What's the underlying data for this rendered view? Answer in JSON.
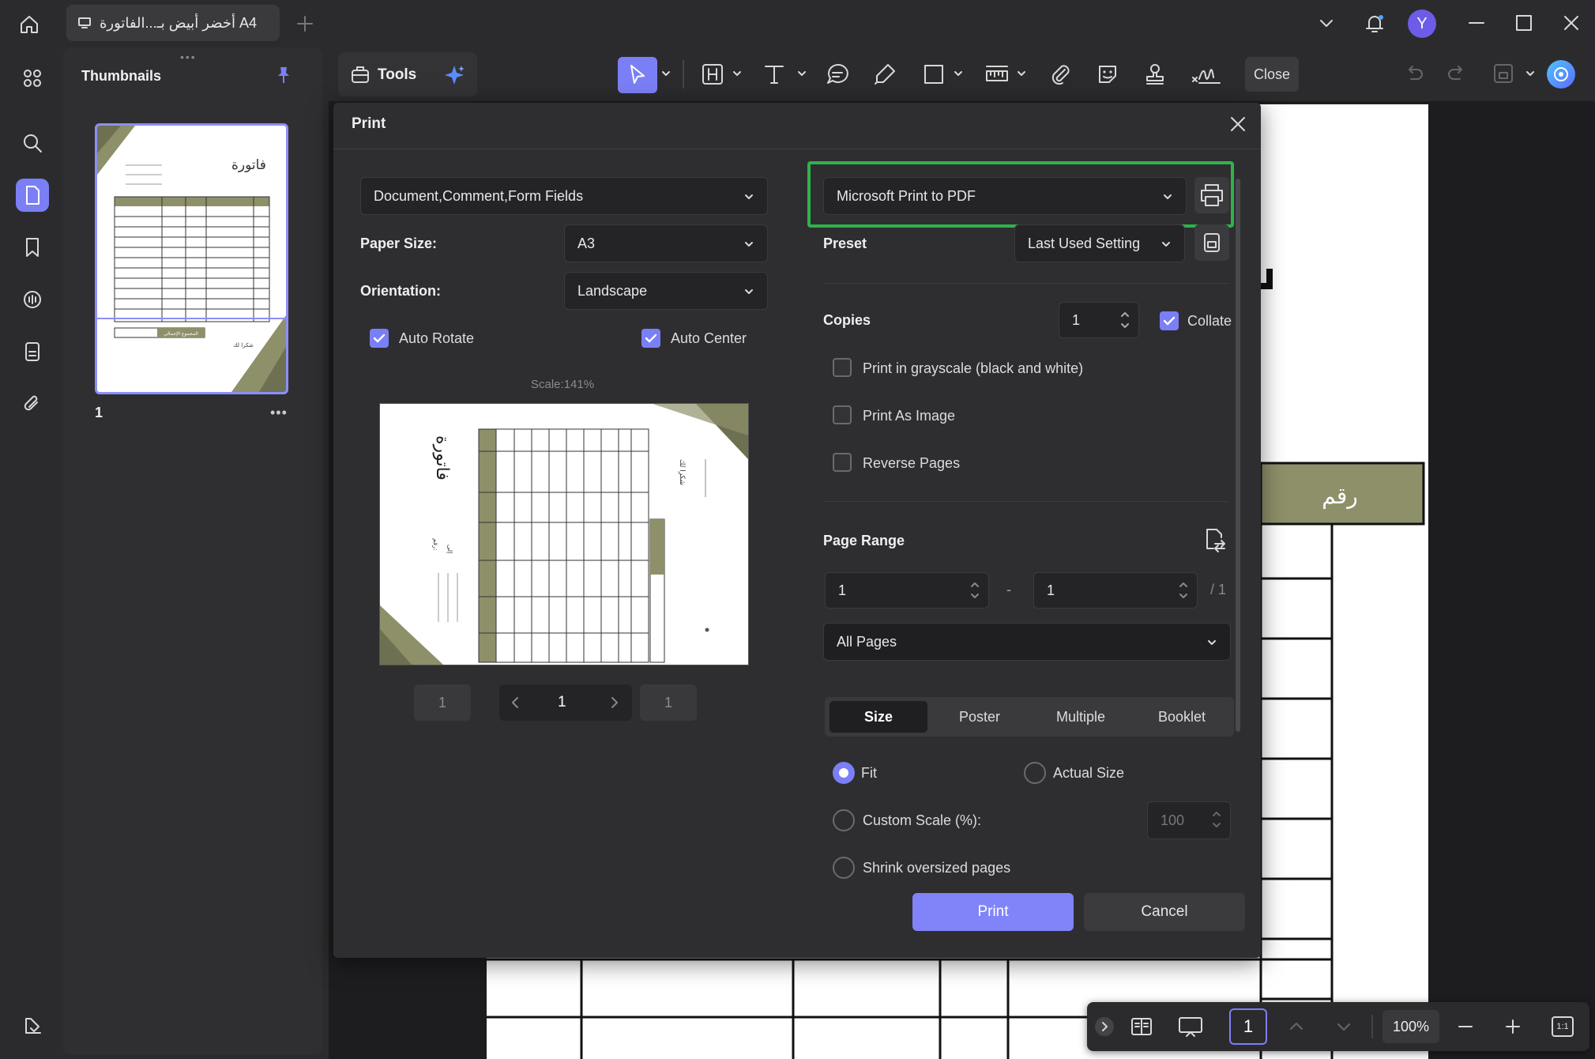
{
  "titlebar": {
    "tab_title": "أخضر أبيض بـ...الفاتورة A4",
    "avatar_letter": "Y"
  },
  "sidebar": {
    "thumbnails_title": "Thumbnails",
    "page_number": "1"
  },
  "toolbar": {
    "tools_label": "Tools",
    "close_label": "Close"
  },
  "dialog": {
    "title": "Print",
    "content_select": "Document,Comment,Form Fields",
    "paper_size_label": "Paper Size:",
    "paper_size_value": "A3",
    "orientation_label": "Orientation:",
    "orientation_value": "Landscape",
    "auto_rotate_label": "Auto Rotate",
    "auto_rotate_checked": true,
    "auto_center_label": "Auto Center",
    "auto_center_checked": true,
    "scale_text": "Scale:141%",
    "preview_prev_page": "1",
    "preview_current_page": "1",
    "preview_next_page": "1",
    "printer_value": "Microsoft Print to PDF",
    "preset_label": "Preset",
    "preset_value": "Last Used Setting",
    "copies_label": "Copies",
    "copies_value": "1",
    "collate_label": "Collate",
    "collate_checked": true,
    "grayscale_label": "Print in grayscale (black and white)",
    "print_as_image_label": "Print As Image",
    "reverse_pages_label": "Reverse Pages",
    "page_range_label": "Page Range",
    "range_from": "1",
    "range_dash": "-",
    "range_to": "1",
    "range_total": "/ 1",
    "pages_select": "All Pages",
    "tabs": [
      "Size",
      "Poster",
      "Multiple",
      "Booklet"
    ],
    "active_tab": "Size",
    "fit_label": "Fit",
    "actual_size_label": "Actual Size",
    "custom_scale_label": "Custom Scale (%):",
    "custom_scale_value": "100",
    "shrink_label": "Shrink oversized pages",
    "print_button": "Print",
    "cancel_button": "Cancel"
  },
  "document": {
    "header_cell_text": "رقم"
  },
  "thumbnail_text": {
    "title": "فاتورة",
    "total_label": "المجموع الإجمالي",
    "thanks": "شكرا لك"
  },
  "preview_text": {
    "title": "فاتورة",
    "number_label": "رقم:",
    "to_label": "إلى",
    "thanks": "شكرا لك"
  },
  "bottombar": {
    "page_value": "1",
    "zoom_value": "100%",
    "fit_label": "1:1"
  },
  "colors": {
    "accent": "#7b7ff5",
    "printer_highlight": "#2fb34a",
    "olive": "#8e906a"
  }
}
